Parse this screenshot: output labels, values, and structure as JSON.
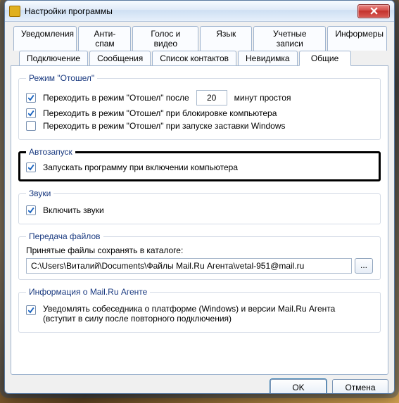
{
  "title": "Настройки программы",
  "close_tooltip": "Закрыть",
  "tabs_row1": [
    {
      "label": "Уведомления"
    },
    {
      "label": "Анти-спам"
    },
    {
      "label": "Голос и видео"
    },
    {
      "label": "Язык"
    },
    {
      "label": "Учетные записи"
    },
    {
      "label": "Информеры"
    }
  ],
  "tabs_row2": [
    {
      "label": "Подключение"
    },
    {
      "label": "Сообщения"
    },
    {
      "label": "Список контактов"
    },
    {
      "label": "Невидимка"
    },
    {
      "label": "Общие",
      "active": true
    }
  ],
  "away": {
    "legend": "Режим \"Отошел\"",
    "opt_after_label": "Переходить в режим \"Отошел\" после",
    "opt_after_checked": true,
    "minutes_value": "20",
    "minutes_suffix": "минут простоя",
    "opt_lock_label": "Переходить в режим \"Отошел\" при блокировке компьютера",
    "opt_lock_checked": true,
    "opt_saver_label": "Переходить в режим \"Отошел\" при запуске заставки Windows",
    "opt_saver_checked": false
  },
  "autorun": {
    "legend": "Автозапуск",
    "opt_label": "Запускать программу при включении компьютера",
    "opt_checked": true
  },
  "sounds": {
    "legend": "Звуки",
    "opt_label": "Включить звуки",
    "opt_checked": true
  },
  "files": {
    "legend": "Передача файлов",
    "caption": "Принятые файлы сохранять в каталоге:",
    "path_value": "C:\\Users\\Виталий\\Documents\\Файлы Mail.Ru Агента\\vetal-951@mail.ru",
    "browse_label": "..."
  },
  "info": {
    "legend": "Информация о Mail.Ru Агенте",
    "opt_label": "Уведомлять собеседника о платформе (Windows) и версии Mail.Ru Агента (вступит в силу после повторного подключения)",
    "opt_checked": true
  },
  "footer": {
    "ok": "OK",
    "cancel": "Отмена"
  }
}
